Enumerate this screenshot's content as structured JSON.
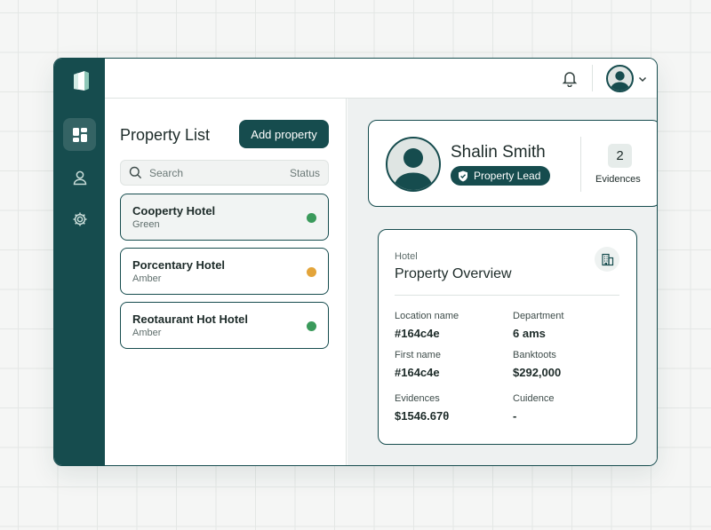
{
  "icons": {
    "logo": "app-logo",
    "rail": [
      "dashboard-icon",
      "user-icon",
      "gear-icon"
    ],
    "notifications": "bell-icon",
    "user_menu": "chevron-down-icon",
    "search": "search-icon",
    "role": "shield-check-icon",
    "overview": "building-icon"
  },
  "colors": {
    "brand": "#164c4e",
    "status_green": "#3a9a5b",
    "status_amber": "#e3a43a"
  },
  "list": {
    "title": "Property List",
    "add_button": "Add property",
    "search_placeholder": "Search",
    "search_status": "Status",
    "items": [
      {
        "name": "Cooperty Hotel",
        "status": "Green",
        "dot_color": "#3a9a5b"
      },
      {
        "name": "Porcentary Hotel",
        "status": "Amber",
        "dot_color": "#e3a43a"
      },
      {
        "name": "Reotaurant Hot Hotel",
        "status": "Amber",
        "dot_color": "#3a9a5b"
      }
    ]
  },
  "profile": {
    "name": "Shalin Smith",
    "role": "Property Lead",
    "evidence_count": "2",
    "evidence_label": "Evidences"
  },
  "overview": {
    "kicker": "Hotel",
    "title": "Property Overview",
    "fields": [
      {
        "label": "Location name",
        "value": "#164c4e"
      },
      {
        "label": "Department",
        "value": "6 ams"
      },
      {
        "label": "First name",
        "value": "#164c4e"
      },
      {
        "label": "Banktoots",
        "value": "$292,000"
      },
      {
        "label": "Evidences",
        "value": "$1546.67θ"
      },
      {
        "label": "Cuidence",
        "value": "-"
      }
    ]
  }
}
